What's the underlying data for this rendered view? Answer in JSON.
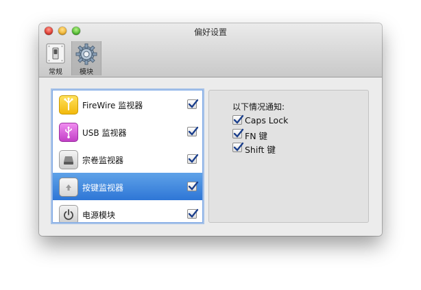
{
  "window": {
    "title": "偏好设置"
  },
  "toolbar": {
    "items": [
      {
        "label": "常规",
        "icon": "switch-icon"
      },
      {
        "label": "模块",
        "icon": "gear-icon",
        "selected": true
      }
    ]
  },
  "modules": {
    "items": [
      {
        "label": "FireWire 监视器",
        "icon": "firewire-icon",
        "checked": true
      },
      {
        "label": "USB 监视器",
        "icon": "usb-icon",
        "checked": true
      },
      {
        "label": "宗卷监视器",
        "icon": "volume-drive-icon",
        "checked": true
      },
      {
        "label": "按键监视器",
        "icon": "keyboard-key-icon",
        "checked": true,
        "selected": true
      },
      {
        "label": "电源模块",
        "icon": "power-icon",
        "checked": true
      }
    ]
  },
  "notifications": {
    "heading": "以下情况通知:",
    "options": [
      {
        "label": "Caps Lock",
        "checked": true
      },
      {
        "label": "FN 键",
        "checked": true
      },
      {
        "label": "Shift 键",
        "checked": true
      }
    ]
  },
  "colors": {
    "selection": "#2e76d6",
    "checkmark": "#1b3f8c"
  }
}
